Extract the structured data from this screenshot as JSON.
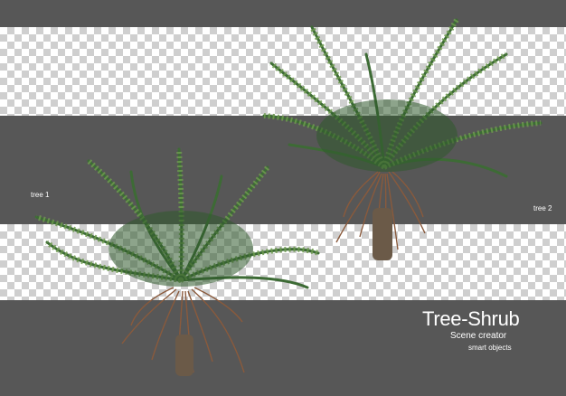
{
  "labels": {
    "tree1": "tree 1",
    "tree2": "tree 2"
  },
  "branding": {
    "title": "Tree-Shrub",
    "subtitle": "Scene creator",
    "tagline": "smart objects"
  },
  "colors": {
    "background": "#575757",
    "checker_light": "#ffffff",
    "checker_dark": "#cfcfcf",
    "frond_dark": "#2f5a2c",
    "frond_light": "#6e9b4f",
    "roots": "#8a5a3c"
  }
}
